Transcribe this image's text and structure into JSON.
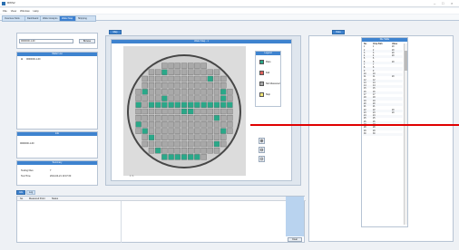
{
  "app": {
    "title": "RWS2",
    "window_controls": [
      "–",
      "□",
      "×"
    ]
  },
  "menu": [
    "File",
    "View",
    "Window",
    "Help"
  ],
  "tabs": [
    "Overview Slots",
    "Dashboard",
    "Wafer Analysis",
    "Wafer Map",
    "Shipping"
  ],
  "left": {
    "lot_section": "Lot",
    "lot_input": "0000000-1-00",
    "browse_label": "Browse",
    "tree_header": "Wafer List",
    "tree_item": "0000000-1-00",
    "info_header": "Info",
    "info_text": "0000000-1-00",
    "stats_header": "Summary",
    "testing_label": "Testing Dies",
    "testing_value": "7",
    "test_time_label": "Test Time",
    "test_time_value": "2014-04-21 10:47:30"
  },
  "center": {
    "tab_label": "Map",
    "map_header": "Wafer Map - 1",
    "legend_header": "Legend",
    "legend": [
      {
        "label": "Pass",
        "color": "#2aa889"
      },
      {
        "label": "Fail",
        "color": "#e0605c"
      },
      {
        "label": "Not Measured",
        "color": "#a9a9a9"
      },
      {
        "label": "Skip",
        "color": "#f2e676"
      }
    ],
    "scroll_label": "1 / 1"
  },
  "right": {
    "tab_label": "Data",
    "table_header": "Die Table",
    "columns": [
      "No.",
      "Chip Path",
      "Value"
    ],
    "rows": [
      [
        "1",
        "1",
        "20"
      ],
      [
        "2",
        "2",
        "20"
      ],
      [
        "3",
        "3",
        "20"
      ],
      [
        "4",
        "4",
        "20"
      ],
      [
        "5",
        "5",
        ""
      ],
      [
        "6",
        "6",
        "20"
      ],
      [
        "7",
        "7",
        ""
      ],
      [
        "8",
        "8",
        ""
      ],
      [
        "9",
        "9",
        ""
      ],
      [
        "10",
        "10",
        ""
      ],
      [
        "11",
        "11",
        "20"
      ],
      [
        "12",
        "12",
        ""
      ],
      [
        "13",
        "13",
        ""
      ],
      [
        "14",
        "14",
        ""
      ],
      [
        "15",
        "15",
        ""
      ],
      [
        "16",
        "16",
        ""
      ],
      [
        "17",
        "17",
        ""
      ],
      [
        "18",
        "18",
        ""
      ],
      [
        "19",
        "19",
        ""
      ],
      [
        "20",
        "20",
        ""
      ],
      [
        "21",
        "21",
        ""
      ],
      [
        "22",
        "22",
        "20"
      ],
      [
        "23",
        "23",
        "20"
      ],
      [
        "24",
        "24",
        ""
      ],
      [
        "25",
        "25",
        ""
      ],
      [
        "26",
        "26",
        ""
      ],
      [
        "27",
        "27",
        ""
      ],
      [
        "28",
        "28",
        ""
      ],
      [
        "29",
        "29",
        ""
      ],
      [
        "30",
        "30",
        ""
      ]
    ]
  },
  "bottom": {
    "tab1": "Info",
    "tab2": "Log",
    "col1": "No.",
    "col2": "Measured Point",
    "col3": "Status",
    "clear_label": "Clear"
  },
  "colors": {
    "accent": "#3e83cf",
    "pass": "#2aa889",
    "untested": "#a9a9a9",
    "pointer": "#e00000"
  }
}
